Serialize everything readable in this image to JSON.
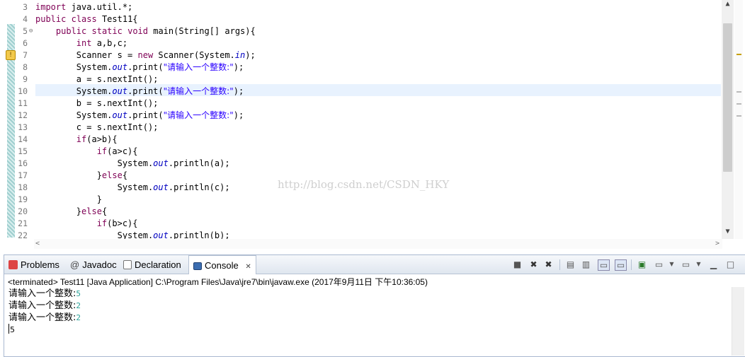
{
  "editor": {
    "lines": [
      {
        "num": "3",
        "tokens": [
          {
            "t": "kw",
            "v": "import"
          },
          {
            "t": "n",
            "v": " java.util.*;"
          }
        ]
      },
      {
        "num": "4",
        "tokens": [
          {
            "t": "kw",
            "v": "public"
          },
          {
            "t": "n",
            "v": " "
          },
          {
            "t": "kw",
            "v": "class"
          },
          {
            "t": "n",
            "v": " Test11{"
          }
        ]
      },
      {
        "num": "5",
        "fold": "⊖",
        "tokens": [
          {
            "t": "n",
            "v": "    "
          },
          {
            "t": "kw",
            "v": "public"
          },
          {
            "t": "n",
            "v": " "
          },
          {
            "t": "kw",
            "v": "static"
          },
          {
            "t": "n",
            "v": " "
          },
          {
            "t": "kw",
            "v": "void"
          },
          {
            "t": "n",
            "v": " main(String[] args){"
          }
        ]
      },
      {
        "num": "6",
        "tokens": [
          {
            "t": "n",
            "v": "        "
          },
          {
            "t": "kw",
            "v": "int"
          },
          {
            "t": "n",
            "v": " a,b,c;"
          }
        ]
      },
      {
        "num": "7",
        "tokens": [
          {
            "t": "n",
            "v": "        Scanner s = "
          },
          {
            "t": "kw",
            "v": "new"
          },
          {
            "t": "n",
            "v": " Scanner(System."
          },
          {
            "t": "fld",
            "v": "in"
          },
          {
            "t": "n",
            "v": ");"
          }
        ]
      },
      {
        "num": "8",
        "tokens": [
          {
            "t": "n",
            "v": "        System."
          },
          {
            "t": "fld",
            "v": "out"
          },
          {
            "t": "n",
            "v": ".print("
          },
          {
            "t": "str",
            "v": "\"请输入一个整数:\""
          },
          {
            "t": "n",
            "v": ");"
          }
        ]
      },
      {
        "num": "9",
        "tokens": [
          {
            "t": "n",
            "v": "        a = s.nextInt();"
          }
        ]
      },
      {
        "num": "10",
        "tokens": [
          {
            "t": "n",
            "v": "        System."
          },
          {
            "t": "fld",
            "v": "out"
          },
          {
            "t": "n",
            "v": ".print("
          },
          {
            "t": "str",
            "v": "\"请输入一个整数:\""
          },
          {
            "t": "n",
            "v": ");"
          }
        ]
      },
      {
        "num": "11",
        "tokens": [
          {
            "t": "n",
            "v": "        b = s.nextInt();"
          }
        ]
      },
      {
        "num": "12",
        "tokens": [
          {
            "t": "n",
            "v": "        System."
          },
          {
            "t": "fld",
            "v": "out"
          },
          {
            "t": "n",
            "v": ".print("
          },
          {
            "t": "str",
            "v": "\"请输入一个整数:\""
          },
          {
            "t": "n",
            "v": ");"
          }
        ]
      },
      {
        "num": "13",
        "tokens": [
          {
            "t": "n",
            "v": "        c = s.nextInt();"
          }
        ]
      },
      {
        "num": "14",
        "tokens": [
          {
            "t": "n",
            "v": "        "
          },
          {
            "t": "kw",
            "v": "if"
          },
          {
            "t": "n",
            "v": "(a>b){"
          }
        ]
      },
      {
        "num": "15",
        "tokens": [
          {
            "t": "n",
            "v": "            "
          },
          {
            "t": "kw",
            "v": "if"
          },
          {
            "t": "n",
            "v": "(a>c){"
          }
        ]
      },
      {
        "num": "16",
        "tokens": [
          {
            "t": "n",
            "v": "                System."
          },
          {
            "t": "fld",
            "v": "out"
          },
          {
            "t": "n",
            "v": ".println(a);"
          }
        ]
      },
      {
        "num": "17",
        "tokens": [
          {
            "t": "n",
            "v": "            }"
          },
          {
            "t": "kw",
            "v": "else"
          },
          {
            "t": "n",
            "v": "{"
          }
        ]
      },
      {
        "num": "18",
        "tokens": [
          {
            "t": "n",
            "v": "                System."
          },
          {
            "t": "fld",
            "v": "out"
          },
          {
            "t": "n",
            "v": ".println(c);"
          }
        ]
      },
      {
        "num": "19",
        "tokens": [
          {
            "t": "n",
            "v": "            }"
          }
        ]
      },
      {
        "num": "20",
        "tokens": [
          {
            "t": "n",
            "v": "        }"
          },
          {
            "t": "kw",
            "v": "else"
          },
          {
            "t": "n",
            "v": "{"
          }
        ]
      },
      {
        "num": "21",
        "tokens": [
          {
            "t": "n",
            "v": "            "
          },
          {
            "t": "kw",
            "v": "if"
          },
          {
            "t": "n",
            "v": "(b>c){"
          }
        ]
      },
      {
        "num": "22",
        "tokens": [
          {
            "t": "n",
            "v": "                System."
          },
          {
            "t": "fld",
            "v": "out"
          },
          {
            "t": "n",
            "v": ".println(b);"
          }
        ]
      }
    ],
    "watermark": "http://blog.csdn.net/CSDN_HKY",
    "colors": {
      "keyword": "#7f0055",
      "string": "#2a00ff",
      "field": "#0000c0",
      "current_line": "#e8f2fe"
    }
  },
  "views": {
    "tabs": [
      {
        "label": "Problems",
        "icon": "problems-icon"
      },
      {
        "label": "Javadoc",
        "icon": "at-icon"
      },
      {
        "label": "Declaration",
        "icon": "declaration-icon"
      },
      {
        "label": "Console",
        "icon": "console-icon",
        "active": true,
        "close": "✕"
      }
    ],
    "status": "<terminated> Test11 [Java Application] C:\\Program Files\\Java\\jre7\\bin\\javaw.exe (2017年9月11日 下午10:36:05)",
    "console_lines": [
      {
        "prompt": "请输入一个整数:",
        "input": "5"
      },
      {
        "prompt": "请输入一个整数:",
        "input": "2"
      },
      {
        "prompt": "请输入一个整数:",
        "input": "2"
      }
    ],
    "current_input": "5"
  }
}
